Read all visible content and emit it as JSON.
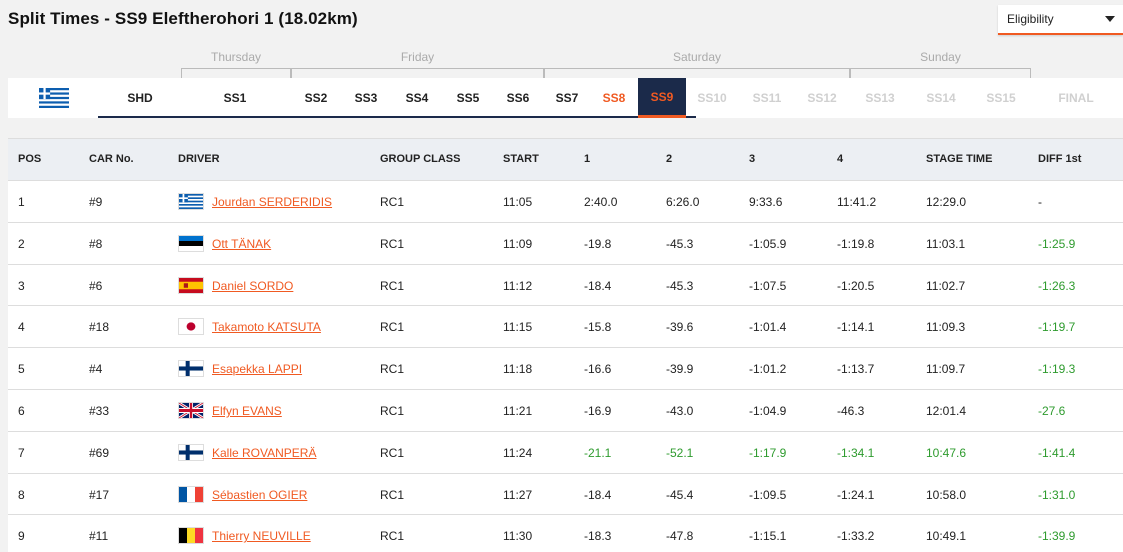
{
  "title": "Split Times - SS9 Eleftherohori 1 (18.02km)",
  "eligibility": {
    "label": "Eligibility"
  },
  "days": [
    "Thursday",
    "Friday",
    "Saturday",
    "Sunday"
  ],
  "stages": [
    "SHD",
    "SS1",
    "SS2",
    "SS3",
    "SS4",
    "SS5",
    "SS6",
    "SS7",
    "SS8",
    "SS9",
    "SS10",
    "SS11",
    "SS12",
    "SS13",
    "SS14",
    "SS15",
    "FINAL"
  ],
  "active_stage": "SS9",
  "columns": [
    "POS",
    "CAR No.",
    "DRIVER",
    "GROUP CLASS",
    "START",
    "1",
    "2",
    "3",
    "4",
    "STAGE TIME",
    "DIFF 1st"
  ],
  "rows": [
    {
      "pos": "1",
      "car": "#9",
      "flag": "greece",
      "driver": "Jourdan SERDERIDIS",
      "class": "RC1",
      "start": "11:05",
      "s1": "2:40.0",
      "s2": "6:26.0",
      "s3": "9:33.6",
      "s4": "11:41.2",
      "stage": "12:29.0",
      "diff": "-"
    },
    {
      "pos": "2",
      "car": "#8",
      "flag": "estonia",
      "driver": "Ott TÄNAK",
      "class": "RC1",
      "start": "11:09",
      "s1": "-19.8",
      "s2": "-45.3",
      "s3": "-1:05.9",
      "s4": "-1:19.8",
      "stage": "11:03.1",
      "diff": "-1:25.9"
    },
    {
      "pos": "3",
      "car": "#6",
      "flag": "spain",
      "driver": "Daniel SORDO",
      "class": "RC1",
      "start": "11:12",
      "s1": "-18.4",
      "s2": "-45.3",
      "s3": "-1:07.5",
      "s4": "-1:20.5",
      "stage": "11:02.7",
      "diff": "-1:26.3"
    },
    {
      "pos": "4",
      "car": "#18",
      "flag": "japan",
      "driver": "Takamoto KATSUTA",
      "class": "RC1",
      "start": "11:15",
      "s1": "-15.8",
      "s2": "-39.6",
      "s3": "-1:01.4",
      "s4": "-1:14.1",
      "stage": "11:09.3",
      "diff": "-1:19.7"
    },
    {
      "pos": "5",
      "car": "#4",
      "flag": "finland",
      "driver": "Esapekka LAPPI",
      "class": "RC1",
      "start": "11:18",
      "s1": "-16.6",
      "s2": "-39.9",
      "s3": "-1:01.2",
      "s4": "-1:13.7",
      "stage": "11:09.7",
      "diff": "-1:19.3"
    },
    {
      "pos": "6",
      "car": "#33",
      "flag": "uk",
      "driver": "Elfyn EVANS",
      "class": "RC1",
      "start": "11:21",
      "s1": "-16.9",
      "s2": "-43.0",
      "s3": "-1:04.9",
      "s4": "-46.3",
      "stage": "12:01.4",
      "diff": "-27.6"
    },
    {
      "pos": "7",
      "car": "#69",
      "flag": "finland",
      "driver": "Kalle ROVANPERÄ",
      "class": "RC1",
      "start": "11:24",
      "s1": "-21.1",
      "s2": "-52.1",
      "s3": "-1:17.9",
      "s4": "-1:34.1",
      "stage": "10:47.6",
      "diff": "-1:41.4",
      "best": true
    },
    {
      "pos": "8",
      "car": "#17",
      "flag": "france",
      "driver": "Sébastien OGIER",
      "class": "RC1",
      "start": "11:27",
      "s1": "-18.4",
      "s2": "-45.4",
      "s3": "-1:09.5",
      "s4": "-1:24.1",
      "stage": "10:58.0",
      "diff": "-1:31.0"
    },
    {
      "pos": "9",
      "car": "#11",
      "flag": "belgium",
      "driver": "Thierry NEUVILLE",
      "class": "RC1",
      "start": "11:30",
      "s1": "-18.3",
      "s2": "-47.8",
      "s3": "-1:15.1",
      "s4": "-1:33.2",
      "stage": "10:49.1",
      "diff": "-1:39.9"
    }
  ],
  "colors": {
    "accent": "#f05a22",
    "navy": "#1b2a4a",
    "green": "#2e9b2e"
  }
}
